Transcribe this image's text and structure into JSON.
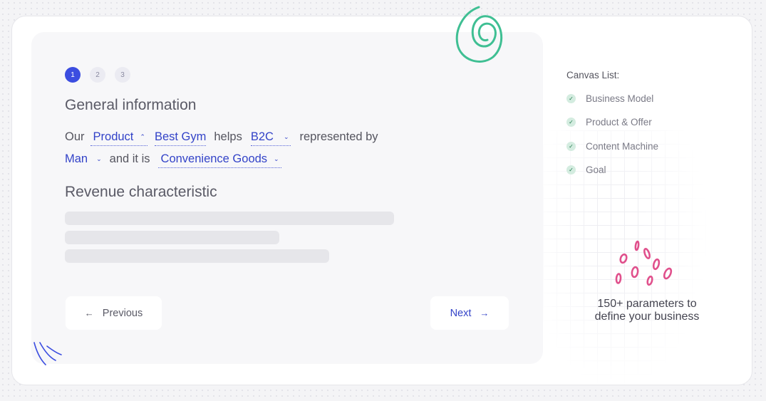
{
  "steps": [
    {
      "label": "1",
      "active": true
    },
    {
      "label": "2",
      "active": false
    },
    {
      "label": "3",
      "active": false
    }
  ],
  "general": {
    "title": "General information",
    "word_our": "Our",
    "product": "Product",
    "business": "Best Gym",
    "word_helps": "helps",
    "market": "B2C",
    "word_represented": "represented by",
    "persona": "Man",
    "word_and_it_is": "and it is",
    "goods_type": "Convenience Goods"
  },
  "revenue": {
    "title": "Revenue characteristic"
  },
  "buttons": {
    "previous": "Previous",
    "next": "Next"
  },
  "canvas": {
    "title": "Canvas List:",
    "items": [
      "Business Model",
      "Product & Offer",
      "Content Machine",
      "Goal"
    ]
  },
  "promo": {
    "line1": "150+ parameters to",
    "line2": "define your business"
  },
  "colors": {
    "accent": "#3b4de0",
    "check": "#d4ece0",
    "doodle_green": "#3fbf93",
    "doodle_pink": "#e0508c"
  },
  "icons": {
    "prev": "arrow-left-icon",
    "next": "arrow-right-icon",
    "check": "check-icon",
    "dropdown": "chevron-icon"
  }
}
